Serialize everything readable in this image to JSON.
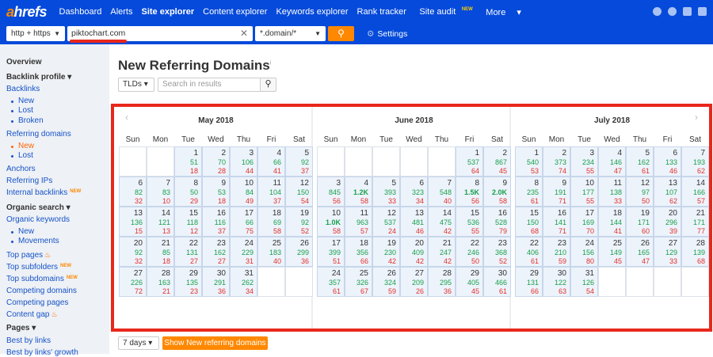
{
  "nav": {
    "logo_a": "a",
    "logo_rest": "hrefs",
    "items": [
      "Dashboard",
      "Alerts",
      "Site explorer",
      "Content explorer",
      "Keywords explorer",
      "Rank tracker",
      "Site audit",
      "More"
    ],
    "new_badge": "NEW"
  },
  "search": {
    "protocol": "http + https",
    "target": "piktochart.com",
    "mode": "*.domain/*",
    "settings": "Settings"
  },
  "sidebar": {
    "overview": "Overview",
    "backlink_profile": "Backlink profile",
    "backlinks": "Backlinks",
    "new": "New",
    "lost": "Lost",
    "broken": "Broken",
    "referring_domains": "Referring domains",
    "anchors": "Anchors",
    "referring_ips": "Referring IPs",
    "internal_backlinks": "Internal backlinks",
    "organic_search": "Organic search",
    "organic_keywords": "Organic keywords",
    "movements": "Movements",
    "top_pages": "Top pages",
    "top_subfolders": "Top subfolders",
    "top_subdomains": "Top subdomains",
    "competing_domains": "Competing domains",
    "competing_pages": "Competing pages",
    "content_gap": "Content gap",
    "pages": "Pages",
    "best_by_links": "Best by links",
    "best_by_links_growth": "Best by links' growth",
    "badge": "NEW"
  },
  "main": {
    "title": "New Referring Domains",
    "info": "i",
    "tlds": "TLDs",
    "search_placeholder": "Search in results",
    "period": "7 days",
    "show_button": "Show New referring domains"
  },
  "calendar": {
    "weekdays": [
      "Sun",
      "Mon",
      "Tue",
      "Wed",
      "Thu",
      "Fri",
      "Sat"
    ],
    "months": [
      {
        "title": "May 2018",
        "days": [
          [
            2,
            1,
            "51",
            "18",
            false
          ],
          [
            3,
            2,
            "70",
            "28",
            false
          ],
          [
            4,
            3,
            "106",
            "44",
            false
          ],
          [
            5,
            4,
            "66",
            "41",
            false
          ],
          [
            6,
            5,
            "92",
            "37",
            false
          ],
          [
            0,
            6,
            "82",
            "32",
            false
          ],
          [
            1,
            7,
            "83",
            "10",
            false
          ],
          [
            2,
            8,
            "50",
            "29",
            false
          ],
          [
            3,
            9,
            "53",
            "18",
            false
          ],
          [
            4,
            10,
            "84",
            "49",
            false
          ],
          [
            5,
            11,
            "104",
            "37",
            false
          ],
          [
            6,
            12,
            "150",
            "54",
            false
          ],
          [
            0,
            13,
            "136",
            "15",
            false
          ],
          [
            1,
            14,
            "121",
            "13",
            false
          ],
          [
            2,
            15,
            "118",
            "12",
            false
          ],
          [
            3,
            16,
            "116",
            "37",
            false
          ],
          [
            4,
            17,
            "66",
            "75",
            false
          ],
          [
            5,
            18,
            "69",
            "58",
            false
          ],
          [
            6,
            19,
            "92",
            "52",
            false
          ],
          [
            0,
            20,
            "92",
            "32",
            false
          ],
          [
            1,
            21,
            "85",
            "18",
            false
          ],
          [
            2,
            22,
            "131",
            "27",
            false
          ],
          [
            3,
            23,
            "162",
            "27",
            false
          ],
          [
            4,
            24,
            "229",
            "31",
            false
          ],
          [
            5,
            25,
            "183",
            "40",
            false
          ],
          [
            6,
            26,
            "299",
            "36",
            false
          ],
          [
            0,
            27,
            "226",
            "72",
            false
          ],
          [
            1,
            28,
            "163",
            "21",
            false
          ],
          [
            2,
            29,
            "135",
            "23",
            false
          ],
          [
            3,
            30,
            "291",
            "36",
            false
          ],
          [
            4,
            31,
            "262",
            "34",
            false
          ]
        ]
      },
      {
        "title": "June 2018",
        "days": [
          [
            5,
            1,
            "537",
            "64",
            false
          ],
          [
            6,
            2,
            "867",
            "45",
            false
          ],
          [
            0,
            3,
            "845",
            "56",
            false
          ],
          [
            1,
            4,
            "1.2K",
            "58",
            true
          ],
          [
            2,
            5,
            "393",
            "33",
            false
          ],
          [
            3,
            6,
            "323",
            "34",
            false
          ],
          [
            4,
            7,
            "548",
            "40",
            false
          ],
          [
            5,
            8,
            "1.5K",
            "56",
            true
          ],
          [
            6,
            9,
            "2.0K",
            "58",
            true
          ],
          [
            0,
            10,
            "1.0K",
            "58",
            true
          ],
          [
            1,
            11,
            "963",
            "57",
            false
          ],
          [
            2,
            12,
            "537",
            "24",
            false
          ],
          [
            3,
            13,
            "481",
            "46",
            false
          ],
          [
            4,
            14,
            "475",
            "42",
            false
          ],
          [
            5,
            15,
            "536",
            "55",
            false
          ],
          [
            6,
            16,
            "528",
            "79",
            false
          ],
          [
            0,
            17,
            "399",
            "51",
            false
          ],
          [
            1,
            18,
            "356",
            "66",
            false
          ],
          [
            2,
            19,
            "230",
            "42",
            false
          ],
          [
            3,
            20,
            "409",
            "42",
            false
          ],
          [
            4,
            21,
            "247",
            "42",
            false
          ],
          [
            5,
            22,
            "246",
            "50",
            false
          ],
          [
            6,
            23,
            "368",
            "52",
            false
          ],
          [
            0,
            24,
            "357",
            "61",
            false
          ],
          [
            1,
            25,
            "326",
            "67",
            false
          ],
          [
            2,
            26,
            "324",
            "59",
            false
          ],
          [
            3,
            27,
            "209",
            "26",
            false
          ],
          [
            4,
            28,
            "295",
            "36",
            false
          ],
          [
            5,
            29,
            "405",
            "45",
            false
          ],
          [
            6,
            30,
            "466",
            "61",
            false
          ]
        ]
      },
      {
        "title": "July 2018",
        "days": [
          [
            0,
            1,
            "540",
            "53",
            false
          ],
          [
            1,
            2,
            "373",
            "74",
            false
          ],
          [
            2,
            3,
            "234",
            "55",
            false
          ],
          [
            3,
            4,
            "146",
            "47",
            false
          ],
          [
            4,
            5,
            "162",
            "61",
            false
          ],
          [
            5,
            6,
            "133",
            "46",
            false
          ],
          [
            6,
            7,
            "193",
            "62",
            false
          ],
          [
            0,
            8,
            "235",
            "61",
            false
          ],
          [
            1,
            9,
            "191",
            "71",
            false
          ],
          [
            2,
            10,
            "177",
            "55",
            false
          ],
          [
            3,
            11,
            "138",
            "33",
            false
          ],
          [
            4,
            12,
            "97",
            "50",
            false
          ],
          [
            5,
            13,
            "107",
            "62",
            false
          ],
          [
            6,
            14,
            "166",
            "57",
            false
          ],
          [
            0,
            15,
            "150",
            "68",
            false
          ],
          [
            1,
            16,
            "141",
            "71",
            false
          ],
          [
            2,
            17,
            "169",
            "70",
            false
          ],
          [
            3,
            18,
            "144",
            "41",
            false
          ],
          [
            4,
            19,
            "171",
            "60",
            false
          ],
          [
            5,
            20,
            "296",
            "39",
            false
          ],
          [
            6,
            21,
            "171",
            "77",
            false
          ],
          [
            0,
            22,
            "406",
            "61",
            false
          ],
          [
            1,
            23,
            "210",
            "59",
            false
          ],
          [
            2,
            24,
            "156",
            "80",
            false
          ],
          [
            3,
            25,
            "149",
            "45",
            false
          ],
          [
            4,
            26,
            "165",
            "47",
            false
          ],
          [
            5,
            27,
            "129",
            "33",
            false
          ],
          [
            6,
            28,
            "139",
            "68",
            false
          ],
          [
            0,
            29,
            "131",
            "66",
            false
          ],
          [
            1,
            30,
            "122",
            "63",
            false
          ],
          [
            2,
            31,
            "126",
            "54",
            false
          ]
        ]
      }
    ]
  }
}
